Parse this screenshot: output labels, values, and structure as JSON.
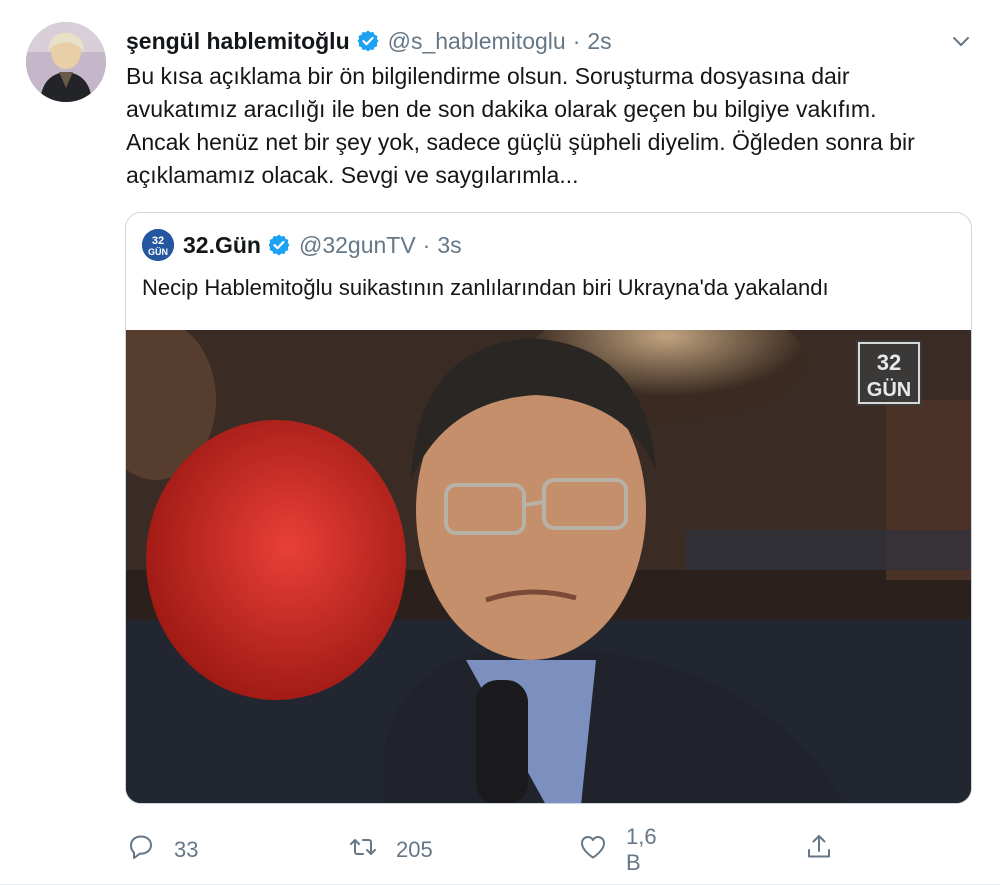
{
  "tweet": {
    "author_name": "şengül hablemitoğlu",
    "author_handle": "@s_hablemitoglu",
    "separator": "·",
    "time": "2s",
    "text_lines": [
      "Bu kısa açıklama bir ön bilgilendirme olsun. Soruşturma dosyasına dair",
      "avukatımız aracılığı ile ben de son dakika olarak geçen bu bilgiye vakıfım.",
      "Ancak henüz net bir şey yok, sadece güçlü şüpheli diyelim. Öğleden sonra bir",
      "açıklamamız olacak. Sevgi ve saygılarımla..."
    ]
  },
  "quoted": {
    "author_name": "32.Gün",
    "author_handle": "@32gunTV",
    "separator": "·",
    "time": "3s",
    "text": "Necip Hablemitoğlu suikastının zanlılarından biri Ukrayna'da yakalandı",
    "logo_text_top": "32",
    "logo_text_bottom": "GÜN",
    "media_watermark_top": "32",
    "media_watermark_bottom": "GÜN"
  },
  "actions": {
    "reply_count": "33",
    "retweet_count": "205",
    "like_count": "1,6 B"
  },
  "icons": [
    "verified-icon",
    "chevron-down-icon",
    "reply-icon",
    "retweet-icon",
    "like-icon",
    "share-icon"
  ],
  "colors": {
    "verified": "#1da1f2",
    "secondary_text": "#657786",
    "border": "#ccd6dd"
  }
}
